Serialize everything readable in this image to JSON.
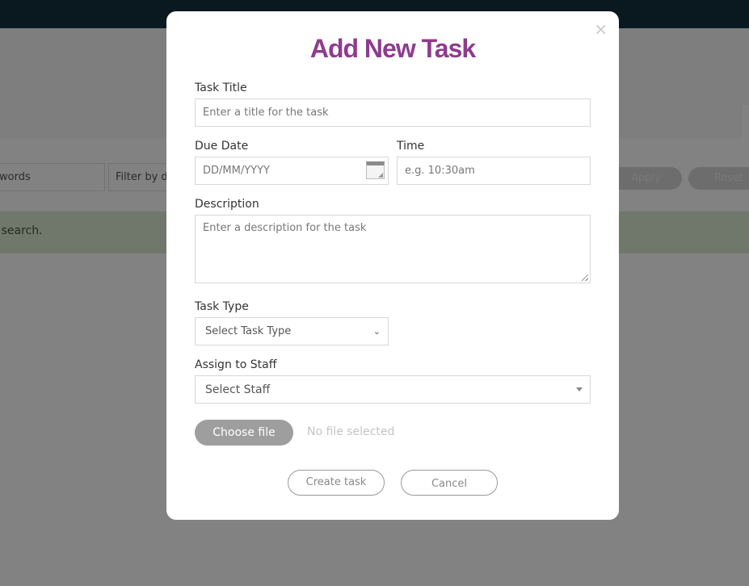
{
  "background": {
    "filters": {
      "keywords_text": "words",
      "due_text": "Filter by du"
    },
    "buttons": {
      "apply": "Apply",
      "reset": "Reset"
    },
    "alert_text": "is search."
  },
  "modal": {
    "title": "Add New Task",
    "close_icon": "×",
    "fields": {
      "task_title": {
        "label": "Task Title",
        "placeholder": "Enter a title for the task"
      },
      "due_date": {
        "label": "Due Date",
        "placeholder": "DD/MM/YYYY"
      },
      "time": {
        "label": "Time",
        "placeholder": "e.g. 10:30am"
      },
      "description": {
        "label": "Description",
        "placeholder": "Enter a description for the task"
      },
      "task_type": {
        "label": "Task Type",
        "selected": "Select Task Type"
      },
      "assign_staff": {
        "label": "Assign to Staff",
        "selected": "Select Staff"
      }
    },
    "file": {
      "button_label": "Choose file",
      "status": "No file selected"
    },
    "actions": {
      "create": "Create task",
      "cancel": "Cancel"
    }
  }
}
